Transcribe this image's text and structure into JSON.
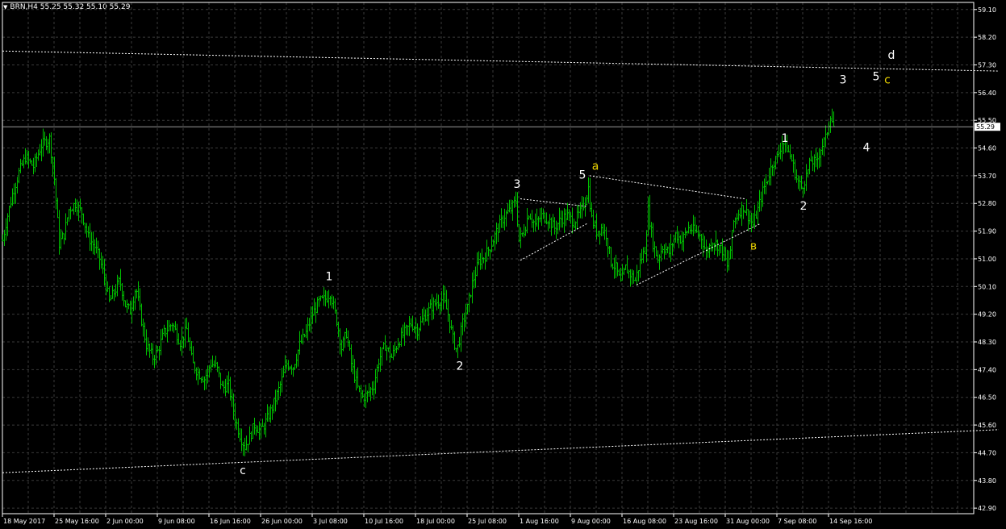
{
  "header": {
    "symbol": "BRN,H4",
    "ohlc": "55.25 55.32 55.10 55.29"
  },
  "chart_data": {
    "type": "candlestick",
    "symbol": "BRN",
    "timeframe": "H4",
    "current_price": 55.29,
    "current_price_label": "55.29",
    "ylim": [
      42.9,
      59.3
    ],
    "y_ticks": [
      "59.10",
      "58.20",
      "57.30",
      "56.40",
      "55.50",
      "54.60",
      "53.70",
      "52.80",
      "51.90",
      "51.00",
      "50.10",
      "49.20",
      "48.30",
      "47.40",
      "46.50",
      "45.60",
      "44.70",
      "43.80",
      "42.90"
    ],
    "x_ticks": [
      "18 May 2017",
      "25 May 16:00",
      "2 Jun 00:00",
      "9 Jun 08:00",
      "16 Jun 16:00",
      "26 Jun 00:00",
      "3 Jul 08:00",
      "10 Jul 16:00",
      "18 Jul 00:00",
      "25 Jul 08:00",
      "1 Aug 16:00",
      "9 Aug 00:00",
      "16 Aug 08:00",
      "23 Aug 16:00",
      "31 Aug 00:00",
      "7 Sep 08:00",
      "14 Sep 16:00"
    ],
    "price_path": [
      [
        0,
        51.6
      ],
      [
        5,
        52.3
      ],
      [
        12,
        53.1
      ],
      [
        20,
        53.8
      ],
      [
        28,
        54.3
      ],
      [
        38,
        54.0
      ],
      [
        48,
        54.7
      ],
      [
        58,
        54.9
      ],
      [
        64,
        53.6
      ],
      [
        70,
        51.5
      ],
      [
        76,
        51.8
      ],
      [
        82,
        52.6
      ],
      [
        90,
        52.8
      ],
      [
        98,
        52.5
      ],
      [
        106,
        51.7
      ],
      [
        114,
        51.4
      ],
      [
        120,
        51.0
      ],
      [
        126,
        50.4
      ],
      [
        132,
        49.6
      ],
      [
        138,
        49.9
      ],
      [
        145,
        50.3
      ],
      [
        152,
        49.5
      ],
      [
        158,
        49.3
      ],
      [
        165,
        50.1
      ],
      [
        172,
        49.0
      ],
      [
        178,
        48.2
      ],
      [
        186,
        47.8
      ],
      [
        192,
        48.0
      ],
      [
        200,
        48.6
      ],
      [
        210,
        48.9
      ],
      [
        220,
        48.3
      ],
      [
        228,
        48.7
      ],
      [
        235,
        47.6
      ],
      [
        242,
        47.3
      ],
      [
        250,
        47.1
      ],
      [
        258,
        47.6
      ],
      [
        265,
        47.5
      ],
      [
        272,
        46.8
      ],
      [
        280,
        46.9
      ],
      [
        288,
        45.8
      ],
      [
        295,
        45.2
      ],
      [
        300,
        44.9
      ],
      [
        306,
        45.2
      ],
      [
        312,
        45.6
      ],
      [
        320,
        45.4
      ],
      [
        328,
        45.8
      ],
      [
        336,
        46.3
      ],
      [
        344,
        46.9
      ],
      [
        352,
        47.6
      ],
      [
        360,
        47.5
      ],
      [
        368,
        48.2
      ],
      [
        376,
        48.6
      ],
      [
        384,
        49.2
      ],
      [
        392,
        49.6
      ],
      [
        400,
        49.7
      ],
      [
        406,
        49.9
      ],
      [
        414,
        49.0
      ],
      [
        420,
        48.1
      ],
      [
        426,
        48.6
      ],
      [
        432,
        47.6
      ],
      [
        440,
        46.8
      ],
      [
        446,
        46.5
      ],
      [
        452,
        46.6
      ],
      [
        460,
        46.9
      ],
      [
        466,
        47.7
      ],
      [
        474,
        48.2
      ],
      [
        482,
        47.8
      ],
      [
        490,
        48.3
      ],
      [
        498,
        48.6
      ],
      [
        506,
        48.9
      ],
      [
        514,
        48.7
      ],
      [
        522,
        49.1
      ],
      [
        530,
        49.4
      ],
      [
        538,
        49.6
      ],
      [
        546,
        49.7
      ],
      [
        552,
        49.2
      ],
      [
        558,
        48.4
      ],
      [
        563,
        48.0
      ],
      [
        570,
        48.9
      ],
      [
        576,
        49.4
      ],
      [
        582,
        50.2
      ],
      [
        590,
        50.9
      ],
      [
        598,
        51.1
      ],
      [
        606,
        51.5
      ],
      [
        614,
        52.0
      ],
      [
        622,
        52.4
      ],
      [
        630,
        52.6
      ],
      [
        636,
        52.9
      ],
      [
        640,
        51.6
      ],
      [
        646,
        51.9
      ],
      [
        652,
        52.5
      ],
      [
        660,
        52.1
      ],
      [
        668,
        52.4
      ],
      [
        676,
        52.3
      ],
      [
        684,
        52.0
      ],
      [
        692,
        52.3
      ],
      [
        700,
        52.4
      ],
      [
        708,
        52.2
      ],
      [
        716,
        52.5
      ],
      [
        722,
        52.9
      ],
      [
        726,
        53.3
      ],
      [
        730,
        52.3
      ],
      [
        736,
        51.9
      ],
      [
        742,
        52.0
      ],
      [
        748,
        51.8
      ],
      [
        754,
        50.9
      ],
      [
        760,
        50.7
      ],
      [
        766,
        50.2
      ],
      [
        772,
        50.7
      ],
      [
        778,
        50.5
      ],
      [
        784,
        50.3
      ],
      [
        790,
        50.9
      ],
      [
        796,
        51.3
      ],
      [
        800,
        52.6
      ],
      [
        806,
        51.5
      ],
      [
        812,
        51.0
      ],
      [
        818,
        51.4
      ],
      [
        826,
        51.2
      ],
      [
        834,
        51.8
      ],
      [
        842,
        51.6
      ],
      [
        850,
        52.0
      ],
      [
        858,
        51.9
      ],
      [
        866,
        51.7
      ],
      [
        872,
        51.2
      ],
      [
        880,
        51.6
      ],
      [
        888,
        51.4
      ],
      [
        894,
        51.2
      ],
      [
        898,
        50.7
      ],
      [
        902,
        51.3
      ],
      [
        906,
        52.2
      ],
      [
        912,
        52.5
      ],
      [
        918,
        52.7
      ],
      [
        924,
        52.4
      ],
      [
        930,
        52.1
      ],
      [
        936,
        52.6
      ],
      [
        942,
        53.2
      ],
      [
        948,
        53.6
      ],
      [
        954,
        54.1
      ],
      [
        960,
        54.3
      ],
      [
        966,
        54.8
      ],
      [
        972,
        54.6
      ],
      [
        978,
        54.2
      ],
      [
        984,
        53.6
      ],
      [
        990,
        53.3
      ],
      [
        996,
        53.7
      ],
      [
        1002,
        54.2
      ],
      [
        1008,
        54.1
      ],
      [
        1014,
        54.6
      ],
      [
        1020,
        54.9
      ],
      [
        1026,
        55.7
      ],
      [
        1030,
        55.3
      ]
    ],
    "wave_labels": [
      {
        "text": "c",
        "price": 44.0,
        "t": 298,
        "color": "#ffffff"
      },
      {
        "text": "1",
        "price": 50.3,
        "t": 405,
        "color": "#ffffff"
      },
      {
        "text": "2",
        "price": 47.4,
        "t": 567,
        "color": "#ffffff"
      },
      {
        "text": "3",
        "price": 53.3,
        "t": 638,
        "color": "#ffffff"
      },
      {
        "text": "5",
        "price": 53.6,
        "t": 719,
        "color": "#ffffff"
      },
      {
        "text": "a",
        "price": 53.9,
        "t": 735,
        "color": "#e8d000"
      },
      {
        "text": "в",
        "price": 51.3,
        "t": 931,
        "color": "#e8d000"
      },
      {
        "text": "1",
        "price": 54.8,
        "t": 970,
        "color": "#ffffff"
      },
      {
        "text": "2",
        "price": 52.6,
        "t": 993,
        "color": "#ffffff"
      },
      {
        "text": "3",
        "price": 56.7,
        "t": 1042,
        "color": "#ffffff"
      },
      {
        "text": "4",
        "price": 54.5,
        "t": 1071,
        "color": "#ffffff"
      },
      {
        "text": "5",
        "price": 56.8,
        "t": 1083,
        "color": "#ffffff"
      },
      {
        "text": "c",
        "price": 56.7,
        "t": 1097,
        "color": "#e8d000"
      },
      {
        "text": "d",
        "price": 57.5,
        "t": 1102,
        "color": "#ffffff"
      }
    ],
    "trendlines": [
      {
        "t1": 0,
        "p1": 57.75,
        "t2": 1235,
        "p2": 57.1
      },
      {
        "t1": 0,
        "p1": 44.05,
        "t2": 1235,
        "p2": 45.45
      },
      {
        "t1": 642,
        "p1": 50.95,
        "t2": 725,
        "p2": 52.15
      },
      {
        "t1": 642,
        "p1": 52.95,
        "t2": 725,
        "p2": 52.7
      },
      {
        "t1": 728,
        "p1": 53.7,
        "t2": 920,
        "p2": 52.95
      },
      {
        "t1": 786,
        "p1": 50.15,
        "t2": 940,
        "p2": 52.15
      }
    ],
    "grid": true,
    "colors": {
      "background": "#000000",
      "candles": "#00c000",
      "grid": "#3a3a3a",
      "axis": "#ffffff"
    }
  }
}
